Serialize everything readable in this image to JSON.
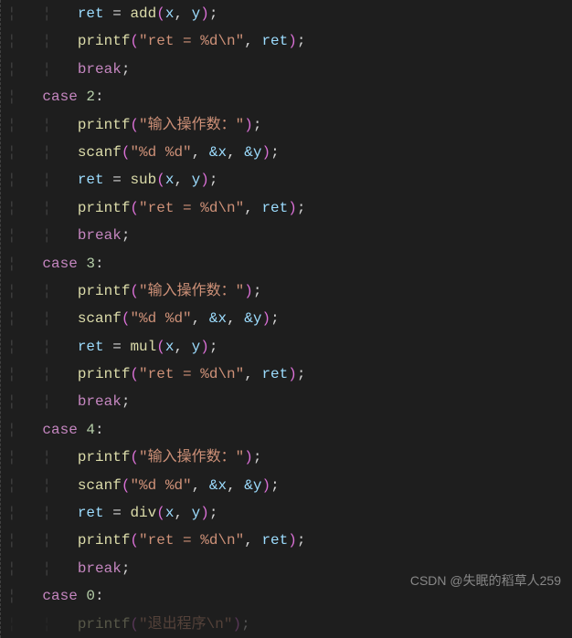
{
  "code": {
    "fn_add": "add",
    "fn_sub": "sub",
    "fn_mul": "mul",
    "fn_div": "div",
    "fn_printf": "printf",
    "fn_scanf": "scanf",
    "var_ret": "ret",
    "var_x": "x",
    "var_y": "y",
    "kw_case": "case",
    "kw_break": "break",
    "num_2": "2",
    "num_3": "3",
    "num_4": "4",
    "num_0": "0",
    "str_prompt": "\"输入操作数：\"",
    "str_scanfmt": "\"%d %d\"",
    "str_retfmt": "\"ret = %d\\n\"",
    "str_exit": "\"退出程序\\n\"",
    "amp_x": "&x",
    "amp_y": "&y",
    "op_assign": " = ",
    "comma": ", ",
    "colon": ":",
    "semi": ";",
    "lp": "(",
    "rp": ")"
  },
  "watermark": "CSDN @失眠的稻草人259"
}
